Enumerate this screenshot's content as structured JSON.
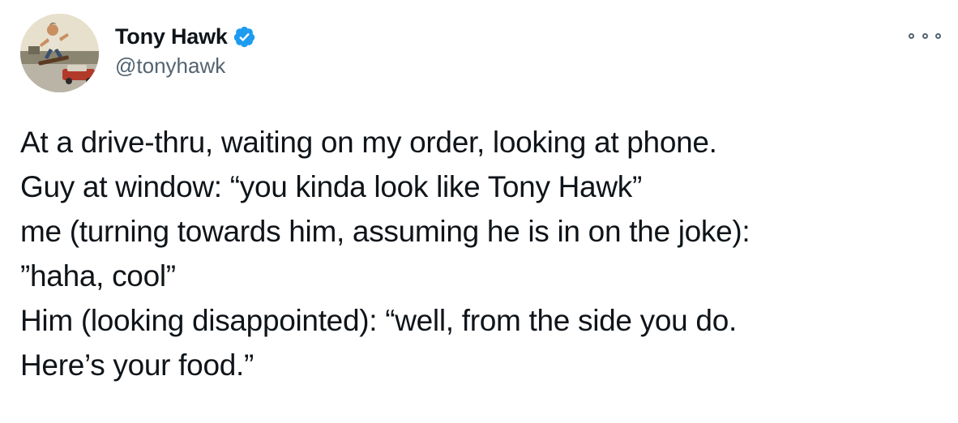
{
  "author": {
    "display_name": "Tony Hawk",
    "handle": "@tonyhawk",
    "verified": true,
    "avatar_icon": "profile-photo-skateboarder"
  },
  "more_icon": "more-options-icon",
  "tweet": {
    "lines": [
      "At a drive-thru, waiting on my order, looking at phone.",
      "Guy at window: “you kinda look like Tony Hawk”",
      "me (turning towards him, assuming he is in on the joke):",
      "”haha, cool”",
      "Him (looking disappointed): “well, from the side you do.",
      "Here’s your food.”"
    ]
  },
  "colors": {
    "verified_blue": "#1d9bf0",
    "secondary_text": "#536471",
    "primary_text": "#0f1419"
  }
}
